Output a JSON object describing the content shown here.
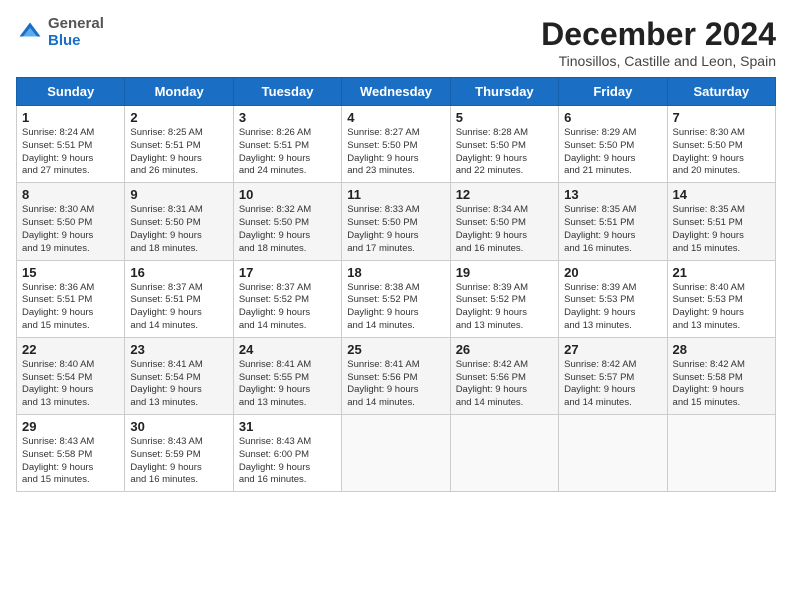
{
  "header": {
    "logo": {
      "line1": "General",
      "line2": "Blue"
    },
    "title": "December 2024",
    "subtitle": "Tinosillos, Castille and Leon, Spain"
  },
  "calendar": {
    "days_of_week": [
      "Sunday",
      "Monday",
      "Tuesday",
      "Wednesday",
      "Thursday",
      "Friday",
      "Saturday"
    ],
    "weeks": [
      [
        {
          "day": "",
          "info": ""
        },
        {
          "day": "2",
          "info": "Sunrise: 8:25 AM\nSunset: 5:51 PM\nDaylight: 9 hours and 26 minutes."
        },
        {
          "day": "3",
          "info": "Sunrise: 8:26 AM\nSunset: 5:51 PM\nDaylight: 9 hours and 24 minutes."
        },
        {
          "day": "4",
          "info": "Sunrise: 8:27 AM\nSunset: 5:50 PM\nDaylight: 9 hours and 23 minutes."
        },
        {
          "day": "5",
          "info": "Sunrise: 8:28 AM\nSunset: 5:50 PM\nDaylight: 9 hours and 22 minutes."
        },
        {
          "day": "6",
          "info": "Sunrise: 8:29 AM\nSunset: 5:50 PM\nDaylight: 9 hours and 21 minutes."
        },
        {
          "day": "7",
          "info": "Sunrise: 8:30 AM\nSunset: 5:50 PM\nDaylight: 9 hours and 20 minutes."
        }
      ],
      [
        {
          "day": "8",
          "info": "Sunrise: 8:30 AM\nSunset: 5:50 PM\nDaylight: 9 hours and 19 minutes."
        },
        {
          "day": "9",
          "info": "Sunrise: 8:31 AM\nSunset: 5:50 PM\nDaylight: 9 hours and 18 minutes."
        },
        {
          "day": "10",
          "info": "Sunrise: 8:32 AM\nSunset: 5:50 PM\nDaylight: 9 hours and 18 minutes."
        },
        {
          "day": "11",
          "info": "Sunrise: 8:33 AM\nSunset: 5:50 PM\nDaylight: 9 hours and 17 minutes."
        },
        {
          "day": "12",
          "info": "Sunrise: 8:34 AM\nSunset: 5:50 PM\nDaylight: 9 hours and 16 minutes."
        },
        {
          "day": "13",
          "info": "Sunrise: 8:35 AM\nSunset: 5:51 PM\nDaylight: 9 hours and 16 minutes."
        },
        {
          "day": "14",
          "info": "Sunrise: 8:35 AM\nSunset: 5:51 PM\nDaylight: 9 hours and 15 minutes."
        }
      ],
      [
        {
          "day": "15",
          "info": "Sunrise: 8:36 AM\nSunset: 5:51 PM\nDaylight: 9 hours and 15 minutes."
        },
        {
          "day": "16",
          "info": "Sunrise: 8:37 AM\nSunset: 5:51 PM\nDaylight: 9 hours and 14 minutes."
        },
        {
          "day": "17",
          "info": "Sunrise: 8:37 AM\nSunset: 5:52 PM\nDaylight: 9 hours and 14 minutes."
        },
        {
          "day": "18",
          "info": "Sunrise: 8:38 AM\nSunset: 5:52 PM\nDaylight: 9 hours and 14 minutes."
        },
        {
          "day": "19",
          "info": "Sunrise: 8:39 AM\nSunset: 5:52 PM\nDaylight: 9 hours and 13 minutes."
        },
        {
          "day": "20",
          "info": "Sunrise: 8:39 AM\nSunset: 5:53 PM\nDaylight: 9 hours and 13 minutes."
        },
        {
          "day": "21",
          "info": "Sunrise: 8:40 AM\nSunset: 5:53 PM\nDaylight: 9 hours and 13 minutes."
        }
      ],
      [
        {
          "day": "22",
          "info": "Sunrise: 8:40 AM\nSunset: 5:54 PM\nDaylight: 9 hours and 13 minutes."
        },
        {
          "day": "23",
          "info": "Sunrise: 8:41 AM\nSunset: 5:54 PM\nDaylight: 9 hours and 13 minutes."
        },
        {
          "day": "24",
          "info": "Sunrise: 8:41 AM\nSunset: 5:55 PM\nDaylight: 9 hours and 13 minutes."
        },
        {
          "day": "25",
          "info": "Sunrise: 8:41 AM\nSunset: 5:56 PM\nDaylight: 9 hours and 14 minutes."
        },
        {
          "day": "26",
          "info": "Sunrise: 8:42 AM\nSunset: 5:56 PM\nDaylight: 9 hours and 14 minutes."
        },
        {
          "day": "27",
          "info": "Sunrise: 8:42 AM\nSunset: 5:57 PM\nDaylight: 9 hours and 14 minutes."
        },
        {
          "day": "28",
          "info": "Sunrise: 8:42 AM\nSunset: 5:58 PM\nDaylight: 9 hours and 15 minutes."
        }
      ],
      [
        {
          "day": "29",
          "info": "Sunrise: 8:43 AM\nSunset: 5:58 PM\nDaylight: 9 hours and 15 minutes."
        },
        {
          "day": "30",
          "info": "Sunrise: 8:43 AM\nSunset: 5:59 PM\nDaylight: 9 hours and 16 minutes."
        },
        {
          "day": "31",
          "info": "Sunrise: 8:43 AM\nSunset: 6:00 PM\nDaylight: 9 hours and 16 minutes."
        },
        {
          "day": "",
          "info": ""
        },
        {
          "day": "",
          "info": ""
        },
        {
          "day": "",
          "info": ""
        },
        {
          "day": "",
          "info": ""
        }
      ]
    ],
    "first_week_special": {
      "day1": {
        "day": "1",
        "info": "Sunrise: 8:24 AM\nSunset: 5:51 PM\nDaylight: 9 hours and 27 minutes."
      }
    }
  }
}
